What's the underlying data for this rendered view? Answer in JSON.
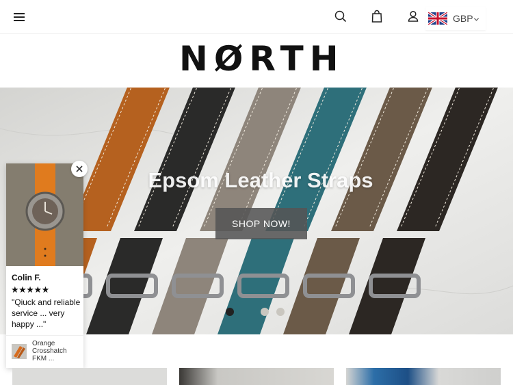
{
  "header": {
    "menu_icon": "hamburger-icon",
    "search_icon": "search-icon",
    "cart_icon": "shopping-bag-icon",
    "account_icon": "user-icon",
    "currency": {
      "code": "GBP",
      "flag_icon": "uk-flag-icon",
      "chevron_icon": "chevron-down-icon"
    }
  },
  "brand": {
    "logo_text": "NØRTH"
  },
  "hero": {
    "title": "Epsom Leather Straps",
    "cta_label": "SHOP NOW!",
    "slides": {
      "count": 3,
      "active_index": 0
    },
    "strap_colors": [
      "#b5611f",
      "#2a2a29",
      "#8e857b",
      "#2e6f7a",
      "#6b5a48",
      "#2c2723"
    ]
  },
  "review_popup": {
    "reviewer": "Colin F.",
    "rating": 5,
    "stars_text": "★★★★★",
    "quote": "\"Qiuck and reliable service ... very happy ...\"",
    "product_name": "Orange Crosshatch FKM ...",
    "close_icon": "close-icon"
  },
  "colors": {
    "accent_dark": "#111111",
    "button_bg": "#555555",
    "dot_inactive": "#c9c6bf"
  }
}
